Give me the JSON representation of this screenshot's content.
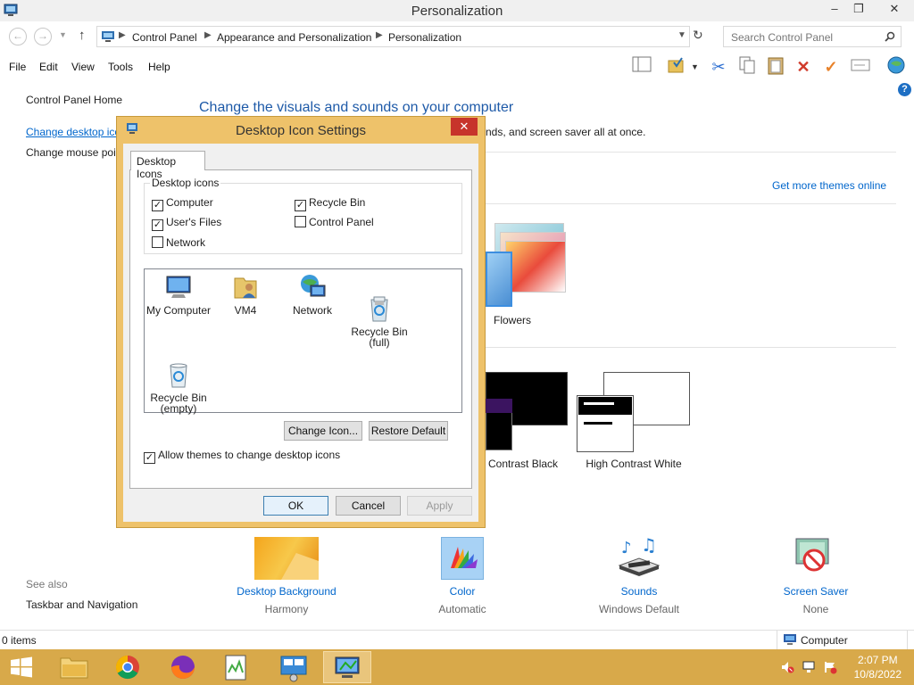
{
  "window": {
    "title": "Personalization",
    "minimize": "–",
    "maximize": "❐",
    "close": "✕"
  },
  "address": {
    "crumbs": [
      "Control Panel",
      "Appearance and Personalization",
      "Personalization"
    ],
    "search_placeholder": "Search Control Panel"
  },
  "menu": [
    "File",
    "Edit",
    "View",
    "Tools",
    "Help"
  ],
  "left_pane": {
    "home": "Control Panel Home",
    "link1": "Change desktop ico",
    "link2": "Change mouse poi",
    "see_also": "See also",
    "taskbar_nav": "Taskbar and Navigation"
  },
  "main": {
    "heading": "Change the visuals and sounds on your computer",
    "subtext": "nds, and screen saver all at once.",
    "get_more": "Get more themes online",
    "themes": [
      {
        "label": "Flowers"
      },
      {
        "label": "n Contrast Black"
      },
      {
        "label": "High Contrast White"
      }
    ],
    "bottom": [
      {
        "label": "Desktop Background",
        "sub": "Harmony"
      },
      {
        "label": "Color",
        "sub": "Automatic"
      },
      {
        "label": "Sounds",
        "sub": "Windows Default"
      },
      {
        "label": "Screen Saver",
        "sub": "None"
      }
    ]
  },
  "dialog": {
    "title": "Desktop Icon Settings",
    "close": "✕",
    "tab": "Desktop Icons",
    "group_label": "Desktop icons",
    "checkboxes": [
      {
        "label": "Computer",
        "checked": true
      },
      {
        "label": "Recycle Bin",
        "checked": true
      },
      {
        "label": "User's Files",
        "checked": true
      },
      {
        "label": "Control Panel",
        "checked": false
      },
      {
        "label": "Network",
        "checked": false
      }
    ],
    "icons": [
      {
        "label": "My Computer",
        "icon": "computer-icon"
      },
      {
        "label": "VM4",
        "icon": "user-folder-icon"
      },
      {
        "label": "Network",
        "icon": "network-icon"
      },
      {
        "label": "Recycle Bin\n(full)",
        "icon": "recycle-bin-full-icon"
      },
      {
        "label": "Recycle Bin\n(empty)",
        "icon": "recycle-bin-empty-icon"
      }
    ],
    "change_icon": "Change Icon...",
    "restore_default": "Restore Default",
    "allow_themes": "Allow themes to change desktop icons",
    "allow_themes_checked": true,
    "ok": "OK",
    "cancel": "Cancel",
    "apply": "Apply"
  },
  "status": {
    "items": "0 items",
    "computer": "Computer"
  },
  "taskbar": {
    "time": "2:07 PM",
    "date": "10/8/2022"
  },
  "colors": {
    "accent_border": "#eec26a",
    "taskbar": "#d8a94a",
    "link": "#0066cc",
    "heading": "#1e5aa8"
  }
}
